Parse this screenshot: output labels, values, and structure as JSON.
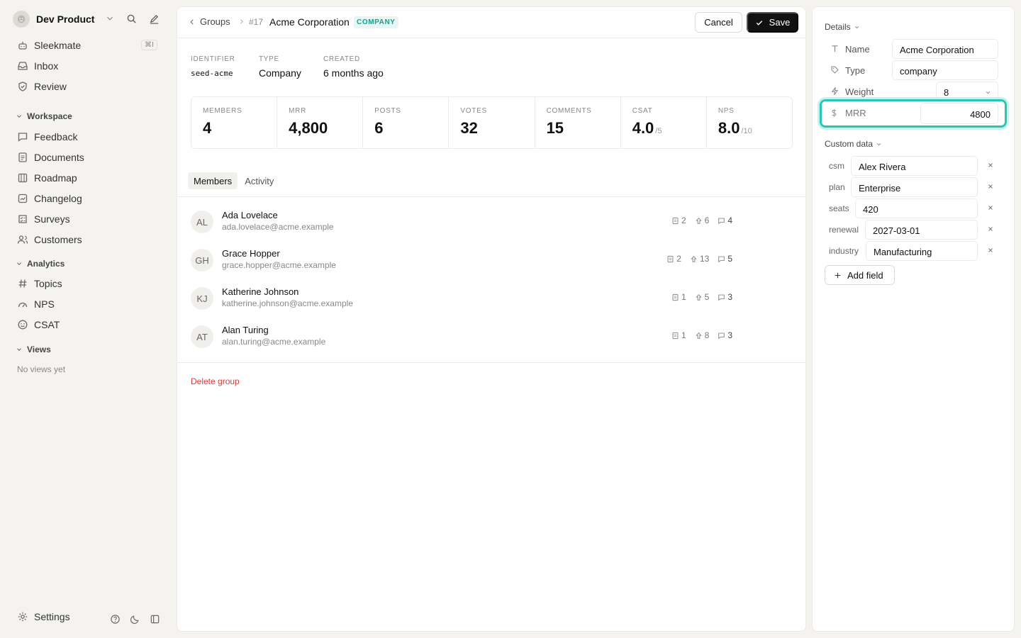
{
  "sidebar": {
    "workspace_name": "Dev Product",
    "items": [
      {
        "label": "Sleekmate",
        "icon": "bot-icon",
        "shortcut": "⌘I"
      },
      {
        "label": "Inbox",
        "icon": "inbox-icon"
      },
      {
        "label": "Review",
        "icon": "shield-check-icon"
      }
    ],
    "workspace_section": "Workspace",
    "workspace_items": [
      {
        "label": "Feedback",
        "icon": "message-square-icon"
      },
      {
        "label": "Documents",
        "icon": "document-icon"
      },
      {
        "label": "Roadmap",
        "icon": "roadmap-icon"
      },
      {
        "label": "Changelog",
        "icon": "changelog-icon"
      },
      {
        "label": "Surveys",
        "icon": "survey-icon"
      },
      {
        "label": "Customers",
        "icon": "users-icon"
      }
    ],
    "analytics_section": "Analytics",
    "analytics_items": [
      {
        "label": "Topics",
        "icon": "hash-icon"
      },
      {
        "label": "NPS",
        "icon": "gauge-icon"
      },
      {
        "label": "CSAT",
        "icon": "smile-icon"
      }
    ],
    "views_section": "Views",
    "no_views": "No views yet",
    "settings": "Settings"
  },
  "header": {
    "back_label": "Groups",
    "group_id": "#17",
    "title": "Acme Corporation",
    "badge": "COMPANY",
    "cancel": "Cancel",
    "save": "Save"
  },
  "meta": {
    "identifier_label": "IDENTIFIER",
    "identifier_value": "seed-acme",
    "type_label": "TYPE",
    "type_value": "Company",
    "created_label": "CREATED",
    "created_value": "6 months ago"
  },
  "stats": [
    {
      "label": "MEMBERS",
      "value": "4",
      "suffix": ""
    },
    {
      "label": "MRR",
      "value": "4,800",
      "suffix": ""
    },
    {
      "label": "POSTS",
      "value": "6",
      "suffix": ""
    },
    {
      "label": "VOTES",
      "value": "32",
      "suffix": ""
    },
    {
      "label": "COMMENTS",
      "value": "15",
      "suffix": ""
    },
    {
      "label": "CSAT",
      "value": "4.0",
      "suffix": "/5"
    },
    {
      "label": "NPS",
      "value": "8.0",
      "suffix": "/10"
    }
  ],
  "tabs": [
    {
      "label": "Members",
      "active": true
    },
    {
      "label": "Activity",
      "active": false
    }
  ],
  "members": [
    {
      "initials": "AL",
      "name": "Ada Lovelace",
      "email": "ada.lovelace@acme.example",
      "posts": "2",
      "votes": "6",
      "comments": "4"
    },
    {
      "initials": "GH",
      "name": "Grace Hopper",
      "email": "grace.hopper@acme.example",
      "posts": "2",
      "votes": "13",
      "comments": "5"
    },
    {
      "initials": "KJ",
      "name": "Katherine Johnson",
      "email": "katherine.johnson@acme.example",
      "posts": "1",
      "votes": "5",
      "comments": "3"
    },
    {
      "initials": "AT",
      "name": "Alan Turing",
      "email": "alan.turing@acme.example",
      "posts": "1",
      "votes": "8",
      "comments": "3"
    }
  ],
  "delete_label": "Delete group",
  "details": {
    "heading": "Details",
    "name_label": "Name",
    "name_value": "Acme Corporation",
    "type_label": "Type",
    "type_value": "company",
    "weight_label": "Weight",
    "weight_value": "8",
    "mrr_label": "MRR",
    "mrr_value": "4800"
  },
  "custom_data": {
    "heading": "Custom data",
    "fields": [
      {
        "key": "csm",
        "value": "Alex Rivera"
      },
      {
        "key": "plan",
        "value": "Enterprise"
      },
      {
        "key": "seats",
        "value": "420"
      },
      {
        "key": "renewal",
        "value": "2027-03-01"
      },
      {
        "key": "industry",
        "value": "Manufacturing"
      }
    ],
    "add_label": "Add field"
  },
  "colors": {
    "accent": "#28c7b3",
    "badge_text": "#17a08f",
    "danger": "#d43c3c",
    "primary_button": "#111111"
  }
}
